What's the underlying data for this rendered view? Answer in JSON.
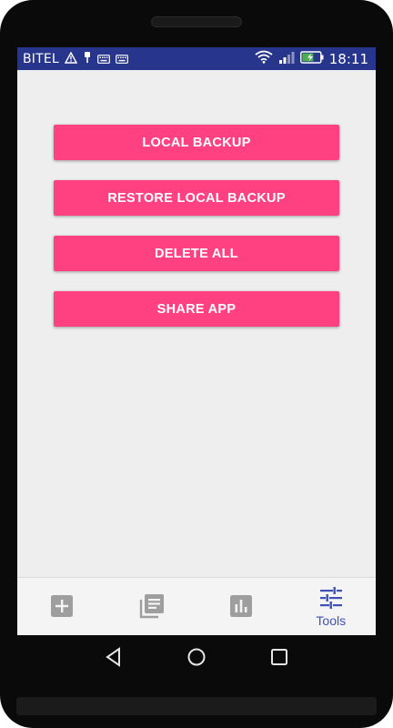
{
  "status_bar": {
    "carrier": "BITEL",
    "time": "18:11",
    "icons": [
      "warning-icon",
      "usb-icon",
      "keyboard-icon",
      "keyboard-icon",
      "wifi-icon",
      "signal-icon",
      "battery-charging-icon"
    ]
  },
  "actions": [
    {
      "label": "LOCAL BACKUP"
    },
    {
      "label": "RESTORE LOCAL BACKUP"
    },
    {
      "label": "DELETE ALL"
    },
    {
      "label": "SHARE APP"
    }
  ],
  "bottom_nav": {
    "items": [
      {
        "icon": "add-box-icon",
        "label": ""
      },
      {
        "icon": "library-books-icon",
        "label": ""
      },
      {
        "icon": "bar-chart-icon",
        "label": ""
      },
      {
        "icon": "tune-icon",
        "label": "Tools",
        "active": true
      }
    ]
  },
  "system_nav": [
    "back-icon",
    "home-icon",
    "recents-icon"
  ],
  "colors": {
    "status_bar": "#27358c",
    "accent": "#ff4081",
    "active_nav": "#3f51b5",
    "inactive_nav": "#9e9e9e",
    "background": "#eeeeee"
  }
}
